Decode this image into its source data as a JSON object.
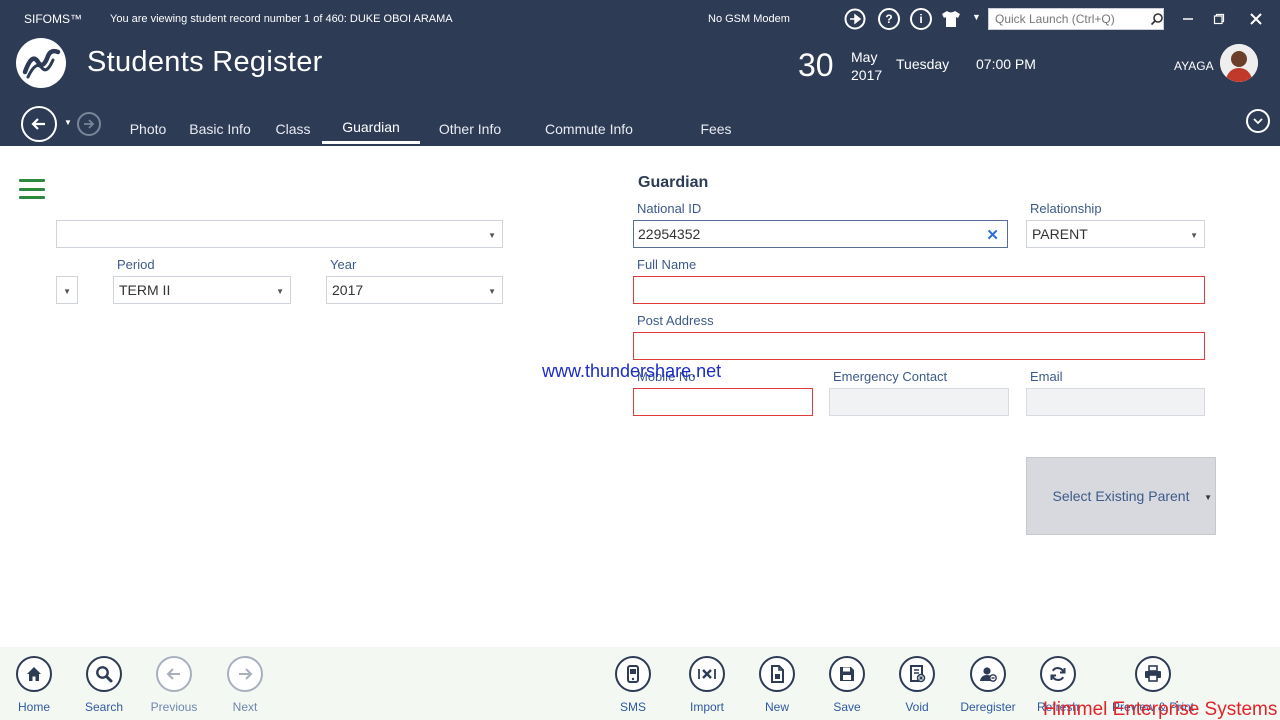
{
  "titlebar": {
    "app_name": "SIFOMS™",
    "status": "You are viewing student record number 1 of 460: DUKE OBOI ARAMA",
    "gsm": "No GSM Modem",
    "quick_launch_placeholder": "Quick Launch (Ctrl+Q)",
    "icons": [
      "plug-icon",
      "help-icon",
      "info-icon",
      "shirt-icon",
      "dropdown-caret-icon"
    ]
  },
  "header": {
    "title": "Students Register",
    "date_day": "30",
    "date_month": "May",
    "date_year": "2017",
    "weekday": "Tuesday",
    "time": "07:00 PM",
    "user": "AYAGA"
  },
  "tabs": [
    {
      "label": "Photo",
      "active": false
    },
    {
      "label": "Basic Info",
      "active": false
    },
    {
      "label": "Class",
      "active": false
    },
    {
      "label": "Guardian",
      "active": true
    },
    {
      "label": "Other Info",
      "active": false
    },
    {
      "label": "Commute Info",
      "active": false
    },
    {
      "label": "Fees",
      "active": false
    }
  ],
  "class_section": {
    "class_value": "",
    "stream_value": "",
    "period_label": "Period",
    "period_value": "TERM II",
    "year_label": "Year",
    "year_value": "2017"
  },
  "guardian": {
    "title": "Guardian",
    "national_id_label": "National ID",
    "national_id_value": "22954352",
    "relationship_label": "Relationship",
    "relationship_value": "PARENT",
    "full_name_label": "Full Name",
    "full_name_value": "",
    "post_address_label": "Post Address",
    "post_address_value": "",
    "mobile_label": "Mobile No",
    "mobile_value": "",
    "emergency_label": "Emergency Contact",
    "emergency_value": "",
    "email_label": "Email",
    "email_value": "",
    "select_parent_label": "Select Existing Parent"
  },
  "watermark": "www.thundershare.net",
  "footer": {
    "buttons": [
      {
        "label": "Home",
        "icon": "home-icon"
      },
      {
        "label": "Search",
        "icon": "search-icon"
      },
      {
        "label": "Previous",
        "icon": "arrow-left-icon"
      },
      {
        "label": "Next",
        "icon": "arrow-right-icon"
      },
      {
        "label": "SMS",
        "icon": "sms-icon"
      },
      {
        "label": "Import",
        "icon": "import-icon"
      },
      {
        "label": "New",
        "icon": "new-document-icon"
      },
      {
        "label": "Save",
        "icon": "save-icon"
      },
      {
        "label": "Void",
        "icon": "void-icon"
      },
      {
        "label": "Deregister",
        "icon": "deregister-icon"
      },
      {
        "label": "Refresh",
        "icon": "refresh-icon"
      },
      {
        "label": "Preview & Print",
        "icon": "print-icon"
      }
    ],
    "brand": "Himmel Enterprise Systems"
  },
  "colors": {
    "header_bg": "#2d3b55",
    "accent_green": "#2d8a3a",
    "label_blue": "#3d5a8a",
    "required_red": "#e03b3b",
    "brand_red": "#e0242a"
  }
}
